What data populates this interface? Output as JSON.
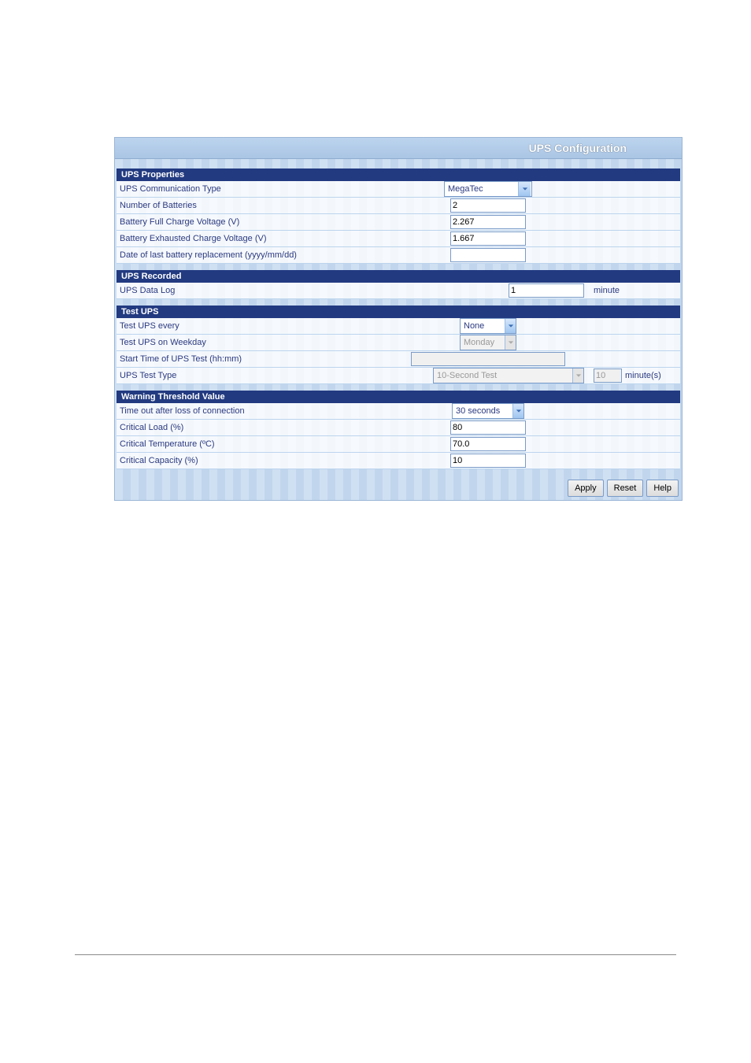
{
  "page_title": "UPS Configuration",
  "sections": {
    "properties": {
      "head": "UPS Properties",
      "comm_type": {
        "label": "UPS Communication Type",
        "value": "MegaTec"
      },
      "num_batteries": {
        "label": "Number of Batteries",
        "value": "2"
      },
      "full_v": {
        "label": "Battery Full Charge Voltage (V)",
        "value": "2.267"
      },
      "exh_v": {
        "label": "Battery Exhausted Charge Voltage (V)",
        "value": "1.667"
      },
      "last_replace": {
        "label": "Date of last battery replacement (yyyy/mm/dd)",
        "value": ""
      }
    },
    "recorded": {
      "head": "UPS Recorded",
      "data_log": {
        "label": "UPS Data Log",
        "value": "1",
        "unit": "minute"
      }
    },
    "test": {
      "head": "Test UPS",
      "every": {
        "label": "Test UPS every",
        "value": "None"
      },
      "weekday": {
        "label": "Test UPS on Weekday",
        "value": "Monday"
      },
      "start_time": {
        "label": "Start Time of UPS Test (hh:mm)",
        "value": ""
      },
      "test_type": {
        "label": "UPS Test Type",
        "value": "10-Second Test",
        "minutes": "10",
        "unit": "minute(s)"
      }
    },
    "warning": {
      "head": "Warning Threshold Value",
      "timeout": {
        "label": "Time out after loss of connection",
        "value": "30 seconds"
      },
      "load": {
        "label": "Critical Load (%)",
        "value": "80"
      },
      "temp": {
        "label": "Critical Temperature (ºC)",
        "value": "70.0"
      },
      "cap": {
        "label": "Critical Capacity (%)",
        "value": "10"
      }
    }
  },
  "buttons": {
    "apply": "Apply",
    "reset": "Reset",
    "help": "Help"
  }
}
